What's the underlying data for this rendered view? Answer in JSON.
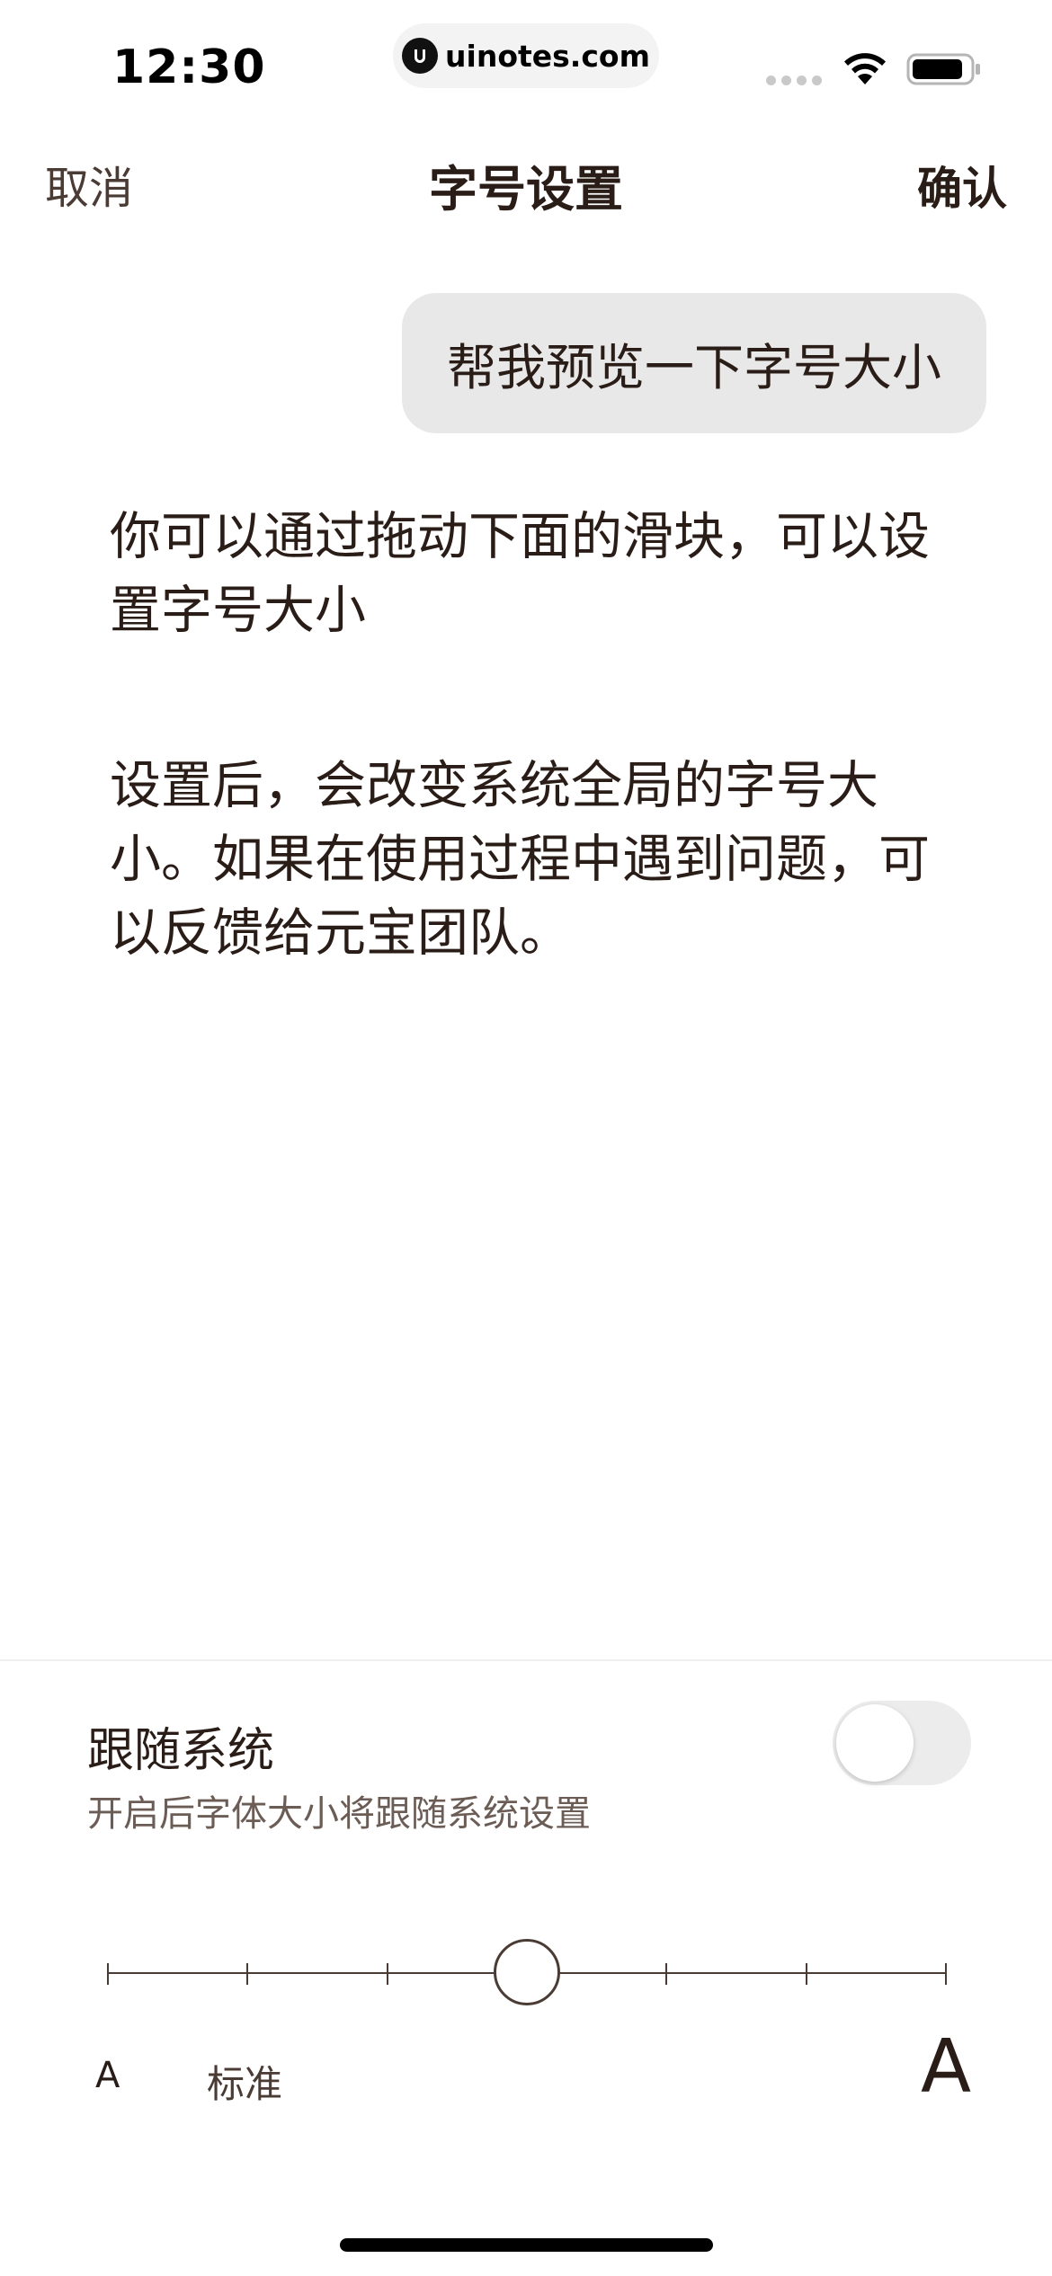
{
  "status_bar": {
    "time": "12:30",
    "url": "uinotes.com"
  },
  "nav": {
    "cancel": "取消",
    "title": "字号设置",
    "confirm": "确认"
  },
  "chat": {
    "user_message": "帮我预览一下字号大小",
    "reply_paragraphs": [
      "你可以通过拖动下面的滑块，可以设置字号大小",
      "设置后，会改变系统全局的字号大小。如果在使用过程中遇到问题，可以反馈给元宝团队。"
    ]
  },
  "follow_system": {
    "title": "跟随系统",
    "subtitle": "开启后字体大小将跟随系统设置",
    "enabled": false
  },
  "font_slider": {
    "steps": 7,
    "selected_step": 4,
    "small_label": "A",
    "standard_label": "标准",
    "large_label": "A"
  }
}
